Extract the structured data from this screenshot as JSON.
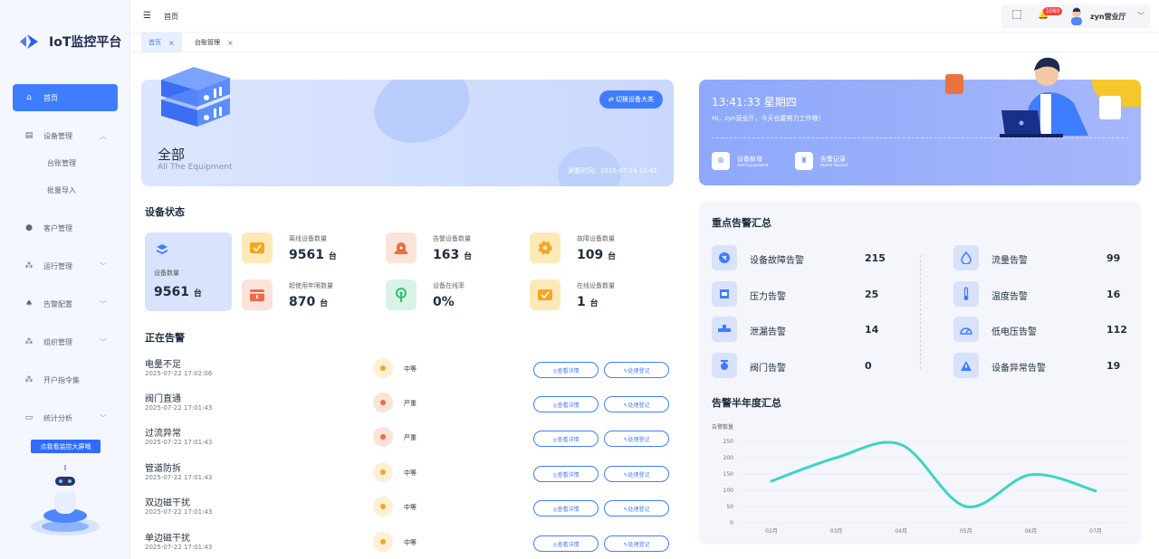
{
  "app": {
    "name": "IoT监控平台"
  },
  "sidebar": {
    "items": [
      {
        "label": "首页",
        "icon": "home-icon",
        "active": true
      },
      {
        "label": "设备管理",
        "icon": "device-icon",
        "expanded": true,
        "children": [
          "台账管理",
          "批量导入"
        ]
      },
      {
        "label": "客户管理",
        "icon": "user-icon"
      },
      {
        "label": "运行管理",
        "icon": "flow-icon"
      },
      {
        "label": "告警配置",
        "icon": "bell-icon"
      },
      {
        "label": "组织管理",
        "icon": "org-icon"
      },
      {
        "label": "开户指令集",
        "icon": "command-icon"
      },
      {
        "label": "统计分析",
        "icon": "chart-icon"
      }
    ],
    "promo": "点我看监控大屏哦"
  },
  "topbar": {
    "breadcrumb": "首页",
    "badge": "1060",
    "user": "zyn营业厅"
  },
  "tabs": [
    {
      "label": "首页",
      "active": true
    },
    {
      "label": "台账管理",
      "active": false
    }
  ],
  "hero": {
    "title": "全部",
    "subtitle": "All The Equipment",
    "switch_label": "⇄ 切换设备大类",
    "refresh": "刷新时间：2025-07-24 13:41"
  },
  "status": {
    "title": "设备状态",
    "total": {
      "label": "设备数量",
      "value": "9561",
      "unit": "台"
    },
    "stats": [
      {
        "label": "离线设备数量",
        "value": "9561",
        "unit": "台",
        "color": "#fde9b8",
        "fg": "#f5a623"
      },
      {
        "label": "告警设备数量",
        "value": "163",
        "unit": "台",
        "color": "#fbe3da",
        "fg": "#ef6b45"
      },
      {
        "label": "故障设备数量",
        "value": "109",
        "unit": "台",
        "color": "#fde9b8",
        "fg": "#f5a623"
      },
      {
        "label": "超使用年限数量",
        "value": "870",
        "unit": "台",
        "color": "#fbe3da",
        "fg": "#ef6b45"
      },
      {
        "label": "设备在线率",
        "value": "0%",
        "unit": "",
        "color": "#d9f3e6",
        "fg": "#2fbf74"
      },
      {
        "label": "在线设备数量",
        "value": "1",
        "unit": "台",
        "color": "#fde9b8",
        "fg": "#f5a623"
      }
    ]
  },
  "alarms": {
    "title": "正在告警",
    "detail_label": "◎查看详情",
    "handle_label": "✎处理登记",
    "rows": [
      {
        "name": "电量不足",
        "time": "2025-07-22 17:02:06",
        "level": "中等",
        "color": "#f5a623",
        "bg": "#fdf0d4"
      },
      {
        "name": "阀门直通",
        "time": "2025-07-22 17:01:43",
        "level": "严重",
        "color": "#ef6b45",
        "bg": "#fbe3da"
      },
      {
        "name": "过流异常",
        "time": "2025-07-22 17:01:43",
        "level": "严重",
        "color": "#ef6b45",
        "bg": "#fbe3da"
      },
      {
        "name": "管道防拆",
        "time": "2025-07-22 17:01:43",
        "level": "中等",
        "color": "#f5a623",
        "bg": "#fdf0d4"
      },
      {
        "name": "双边磁干扰",
        "time": "2025-07-22 17:01:43",
        "level": "中等",
        "color": "#f5a623",
        "bg": "#fdf0d4"
      },
      {
        "name": "单边磁干扰",
        "time": "2025-07-22 17:01:43",
        "level": "中等",
        "color": "#f5a623",
        "bg": "#fdf0d4"
      }
    ]
  },
  "welcome": {
    "time": "13:41:33 星期四",
    "greeting": "Hi，zyn营业厅，今天也要努力工作哦！",
    "actions": [
      {
        "title": "设备新增",
        "sub": "Add Equipment"
      },
      {
        "title": "告警记录",
        "sub": "Alarm Record"
      }
    ]
  },
  "key_alarms": {
    "title": "重点告警汇总",
    "left": [
      {
        "label": "设备故障告警",
        "value": "215"
      },
      {
        "label": "压力告警",
        "value": "25"
      },
      {
        "label": "泄漏告警",
        "value": "14"
      },
      {
        "label": "阀门告警",
        "value": "0"
      }
    ],
    "right": [
      {
        "label": "流量告警",
        "value": "99"
      },
      {
        "label": "温度告警",
        "value": "16"
      },
      {
        "label": "低电压告警",
        "value": "112"
      },
      {
        "label": "设备异常告警",
        "value": "19"
      }
    ]
  },
  "chart_data": {
    "type": "line",
    "title": "告警半年度汇总",
    "ylabel": "告警数量",
    "categories": [
      "02月",
      "03月",
      "04月",
      "05月",
      "06月",
      "07月"
    ],
    "yticks": [
      "0",
      "50",
      "100",
      "150",
      "200",
      "250"
    ],
    "ylim": [
      0,
      250
    ],
    "series": [
      {
        "values": [
          128,
          200,
          240,
          50,
          148,
          98
        ]
      }
    ],
    "color": "#3dd3c8"
  }
}
